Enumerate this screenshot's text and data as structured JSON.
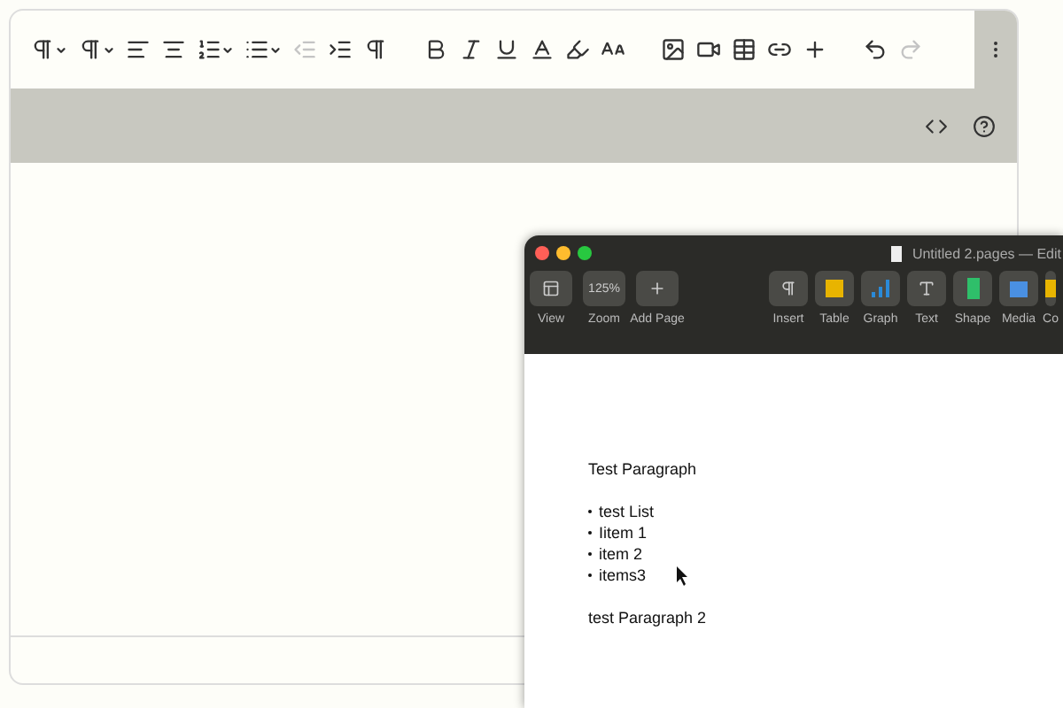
{
  "editor": {
    "toolbar_groups": [
      [
        {
          "kind": "paragraph",
          "dropdown": true,
          "disabled": false
        },
        {
          "kind": "paragraph-style",
          "dropdown": true,
          "disabled": false
        },
        {
          "kind": "align-left",
          "dropdown": false,
          "disabled": false
        },
        {
          "kind": "align-center",
          "dropdown": false,
          "disabled": false
        },
        {
          "kind": "ordered-list",
          "dropdown": true,
          "disabled": false
        },
        {
          "kind": "bullet-list",
          "dropdown": true,
          "disabled": false
        },
        {
          "kind": "outdent",
          "dropdown": false,
          "disabled": true
        },
        {
          "kind": "indent",
          "dropdown": false,
          "disabled": false
        },
        {
          "kind": "show-blocks",
          "dropdown": false,
          "disabled": false
        }
      ],
      [
        {
          "kind": "bold",
          "dropdown": false,
          "disabled": false
        },
        {
          "kind": "italic",
          "dropdown": false,
          "disabled": false
        },
        {
          "kind": "underline",
          "dropdown": false,
          "disabled": false
        },
        {
          "kind": "text-color",
          "dropdown": false,
          "disabled": false
        },
        {
          "kind": "highlight",
          "dropdown": false,
          "disabled": false
        },
        {
          "kind": "font-size",
          "dropdown": false,
          "disabled": false
        }
      ],
      [
        {
          "kind": "image",
          "dropdown": false,
          "disabled": false
        },
        {
          "kind": "video",
          "dropdown": false,
          "disabled": false
        },
        {
          "kind": "table",
          "dropdown": false,
          "disabled": false
        },
        {
          "kind": "link",
          "dropdown": false,
          "disabled": false
        },
        {
          "kind": "insert",
          "dropdown": false,
          "disabled": false
        }
      ],
      [
        {
          "kind": "undo",
          "dropdown": false,
          "disabled": false
        },
        {
          "kind": "redo",
          "dropdown": false,
          "disabled": true
        }
      ]
    ]
  },
  "pages_window": {
    "title": "Untitled 2.pages — Edit",
    "toolbar": [
      {
        "kind": "view",
        "label": "View"
      },
      {
        "kind": "zoom",
        "label": "Zoom",
        "value": "125%"
      },
      {
        "kind": "add-page",
        "label": "Add Page"
      },
      {
        "kind": "spacer"
      },
      {
        "kind": "insert",
        "label": "Insert"
      },
      {
        "kind": "table",
        "label": "Table"
      },
      {
        "kind": "graph",
        "label": "Graph"
      },
      {
        "kind": "text",
        "label": "Text"
      },
      {
        "kind": "shape",
        "label": "Shape"
      },
      {
        "kind": "media",
        "label": "Media"
      },
      {
        "kind": "comment",
        "label": "Co"
      }
    ],
    "document": [
      {
        "kind": "paragraph",
        "text": "Test Paragraph"
      },
      {
        "kind": "list",
        "items": [
          "test List",
          "Iitem 1",
          "item 2",
          "items3"
        ]
      },
      {
        "kind": "paragraph",
        "text": "test Paragraph 2"
      }
    ]
  }
}
